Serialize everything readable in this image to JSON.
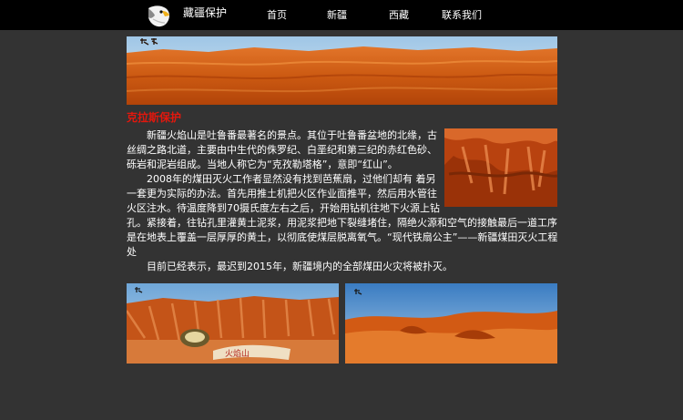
{
  "header": {
    "brand": "藏疆保护",
    "logo_icon": "eagle-icon",
    "nav": [
      {
        "label": "首页"
      },
      {
        "label": "新疆"
      },
      {
        "label": "西藏"
      },
      {
        "label": "联系我们"
      }
    ]
  },
  "banner": {
    "seal_icon": "calligraphy-seal-icon"
  },
  "section": {
    "title": "克拉斯保护",
    "paragraphs": [
      "新疆火焰山是吐鲁番最著名的景点。其位于吐鲁番盆地的北缘，古丝绸之路北道，主要由中生代的侏罗纪、白垩纪和第三纪的赤红色砂、砾岩和泥岩组成。当地人称它为“克孜勒塔格”，意即“红山”。",
      "2008年的煤田灭火工作者显然没有找到芭蕉扇，过他们却有 着另一套更为实际的办法。首先用推土机把火区作业面推平，然后用水管往火区注水。待温度降到70摄氏度左右之后，开始用钻机往地下火源上钻孔。紧接着，往钻孔里灌黄土泥浆，用泥浆把地下裂缝堵住，隔绝火源和空气的接触最后一道工序是在地表上覆盖一层厚厚的黄土，以彻底使煤层脱离氧气。“现代铁扇公主”——新疆煤田灭火工程处",
      "目前已经表示，最迟到2015年，新疆境内的全部煤田火灾将被扑灭。"
    ]
  },
  "photos": {
    "stone_text": "火焰山"
  },
  "colors": {
    "topbar": "#000000",
    "background": "#333333",
    "title_red": "#e3170d"
  }
}
